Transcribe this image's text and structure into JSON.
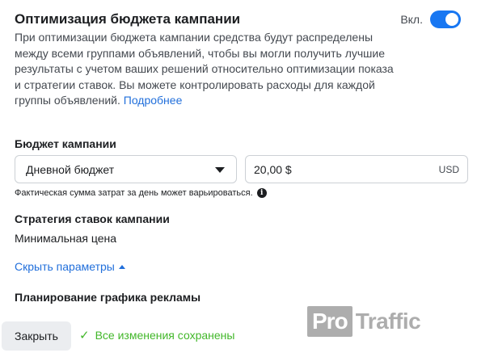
{
  "header": {
    "title": "Оптимизация бюджета кампании",
    "toggle_label": "Вкл."
  },
  "description": {
    "text": "При оптимизации бюджета кампании средства будут распределены между всеми группами объявлений, чтобы вы могли получить лучшие результаты с учетом ваших решений относительно оптимизации показа и стратегии ставок. Вы можете контролировать расходы для каждой группы объявлений.",
    "link": "Подробнее"
  },
  "budget": {
    "label": "Бюджет кампании",
    "type_value": "Дневной бюджет",
    "amount_value": "20,00 $",
    "currency": "USD",
    "hint": "Фактическая сумма затрат за день может варьироваться."
  },
  "bid_strategy": {
    "label": "Стратегия ставок кампании",
    "value": "Минимальная цена"
  },
  "hide_params_link": "Скрыть параметры",
  "scheduling": {
    "label": "Планирование графика рекламы"
  },
  "footer": {
    "close_label": "Закрыть",
    "saved_text": "Все изменения сохранены"
  },
  "watermark": {
    "part1": "Pro",
    "part2": "Traffic"
  },
  "colors": {
    "accent": "#1877f2",
    "link": "#216fdb",
    "success": "#42b72a"
  },
  "icons": [
    "info-icon",
    "check-icon",
    "caret-down-icon",
    "caret-up-icon"
  ]
}
